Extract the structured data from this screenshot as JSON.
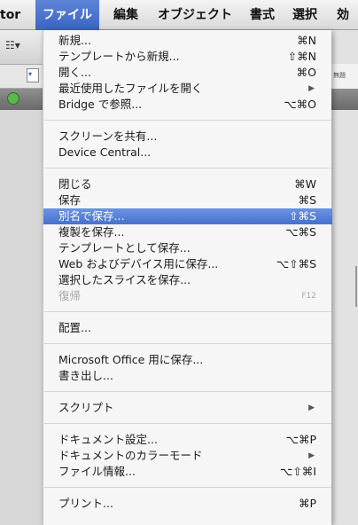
{
  "menubar": {
    "items": [
      "tor",
      "ファイル",
      "編集",
      "オブジェクト",
      "書式",
      "選択",
      "効"
    ],
    "active_index": 1,
    "accent": "#3a63c2"
  },
  "menu": {
    "groups": [
      [
        {
          "label": "新規...",
          "shortcut": "⌘N"
        },
        {
          "label": "テンプレートから新規...",
          "shortcut": "⇧⌘N"
        },
        {
          "label": "開く...",
          "shortcut": "⌘O"
        },
        {
          "label": "最近使用したファイルを開く",
          "submenu": true
        },
        {
          "label": "Bridge で参照...",
          "shortcut": "⌥⌘O"
        }
      ],
      [
        {
          "label": "スクリーンを共有..."
        },
        {
          "label": "Device Central..."
        }
      ],
      [
        {
          "label": "閉じる",
          "shortcut": "⌘W"
        },
        {
          "label": "保存",
          "shortcut": "⌘S"
        },
        {
          "label": "別名で保存...",
          "shortcut": "⇧⌘S",
          "highlighted": true
        },
        {
          "label": "複製を保存...",
          "shortcut": "⌥⌘S"
        },
        {
          "label": "テンプレートとして保存..."
        },
        {
          "label": "Web およびデバイス用に保存...",
          "shortcut": "⌥⇧⌘S"
        },
        {
          "label": "選択したスライスを保存..."
        },
        {
          "label": "復帰",
          "shortcut": "F12",
          "disabled": true
        }
      ],
      [
        {
          "label": "配置..."
        }
      ],
      [
        {
          "label": "Microsoft Office 用に保存..."
        },
        {
          "label": "書き出し..."
        }
      ],
      [
        {
          "label": "スクリプト",
          "submenu": true
        }
      ],
      [
        {
          "label": "ドキュメント設定...",
          "shortcut": "⌥⌘P"
        },
        {
          "label": "ドキュメントのカラーモード",
          "submenu": true
        },
        {
          "label": "ファイル情報...",
          "shortcut": "⌥⇧⌘I"
        }
      ],
      [
        {
          "label": "プリント...",
          "shortcut": "⌘P"
        }
      ]
    ]
  },
  "background": {
    "right_label": "無題"
  }
}
